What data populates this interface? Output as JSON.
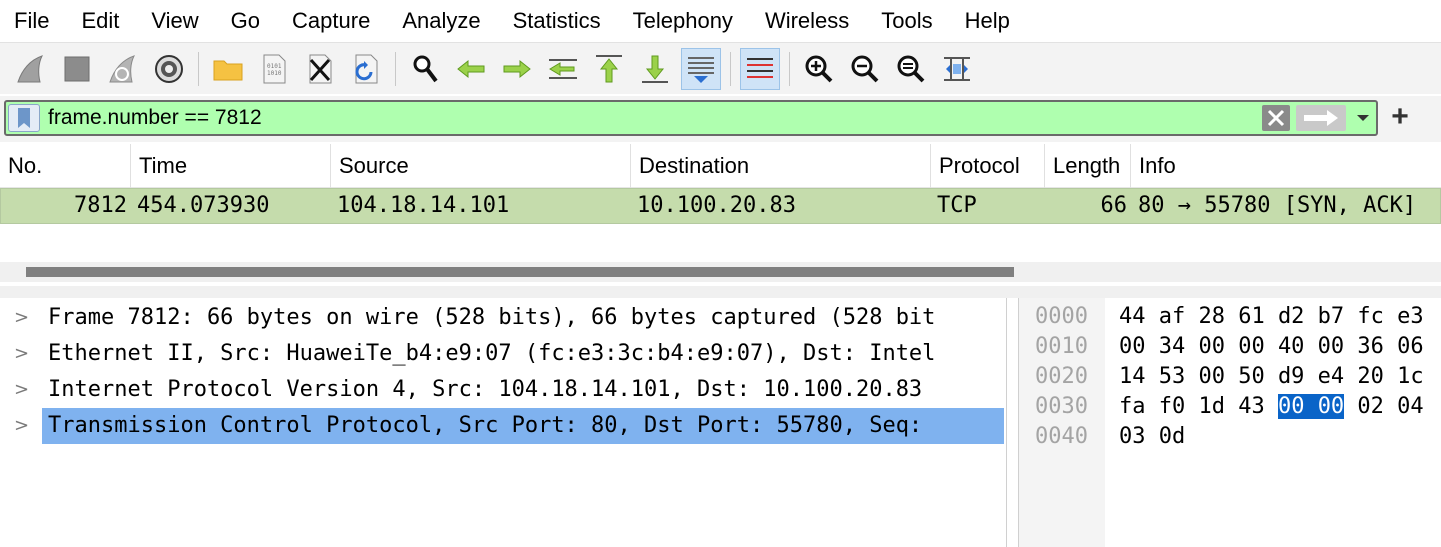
{
  "menu": [
    "File",
    "Edit",
    "View",
    "Go",
    "Capture",
    "Analyze",
    "Statistics",
    "Telephony",
    "Wireless",
    "Tools",
    "Help"
  ],
  "toolbar": {
    "icons": [
      "shark-fin-start-icon",
      "stop-square-icon",
      "shark-fin-restart-icon",
      "gear-options-icon",
      "folder-open-icon",
      "file-binary-icon",
      "file-close-icon",
      "reload-file-icon",
      "find-magnifier-icon",
      "go-back-arrow-icon",
      "go-forward-arrow-icon",
      "go-to-packet-icon",
      "go-first-icon",
      "go-last-icon",
      "autoscroll-icon",
      "colorize-icon",
      "zoom-in-icon",
      "zoom-out-icon",
      "zoom-normal-icon",
      "resize-columns-icon"
    ],
    "active": [
      "autoscroll-icon",
      "colorize-icon"
    ]
  },
  "filter": {
    "value": "frame.number == 7812",
    "add_label": "+"
  },
  "packet_list": {
    "columns": [
      "No.",
      "Time",
      "Source",
      "Destination",
      "Protocol",
      "Length",
      "Info"
    ],
    "rows": [
      {
        "no": "7812",
        "time": "454.073930",
        "source": "104.18.14.101",
        "destination": "10.100.20.83",
        "protocol": "TCP",
        "length": "66",
        "info": "80 → 55780 [SYN, ACK]"
      }
    ],
    "row_color": "#c5dcac"
  },
  "details": [
    {
      "text": "Frame 7812: 66 bytes on wire (528 bits), 66 bytes captured (528 bit"
    },
    {
      "text": "Ethernet II, Src: HuaweiTe_b4:e9:07 (fc:e3:3c:b4:e9:07), Dst: Intel"
    },
    {
      "text": "Internet Protocol Version 4, Src: 104.18.14.101, Dst: 10.100.20.83"
    },
    {
      "text": "Transmission Control Protocol, Src Port: 80, Dst Port: 55780, Seq:"
    }
  ],
  "details_selected_index": 3,
  "bytes": {
    "offsets": [
      "0000",
      "0010",
      "0020",
      "0030",
      "0040"
    ],
    "lines": [
      {
        "pre": "44 af 28 61 d2 b7 fc e3",
        "hl": "",
        "post": ""
      },
      {
        "pre": "00 34 00 00 40 00 36 06",
        "hl": "",
        "post": ""
      },
      {
        "pre": "14 53 00 50 d9 e4 20 1c",
        "hl": "",
        "post": ""
      },
      {
        "pre": "fa f0 1d 43 ",
        "hl": "00 00",
        "post": " 02 04"
      },
      {
        "pre": "03 0d",
        "hl": "",
        "post": ""
      }
    ]
  },
  "colors": {
    "filter_valid_bg": "#afffaf",
    "selected_tree_bg": "#7fb2ef",
    "bytes_highlight": "#0a64c8"
  }
}
